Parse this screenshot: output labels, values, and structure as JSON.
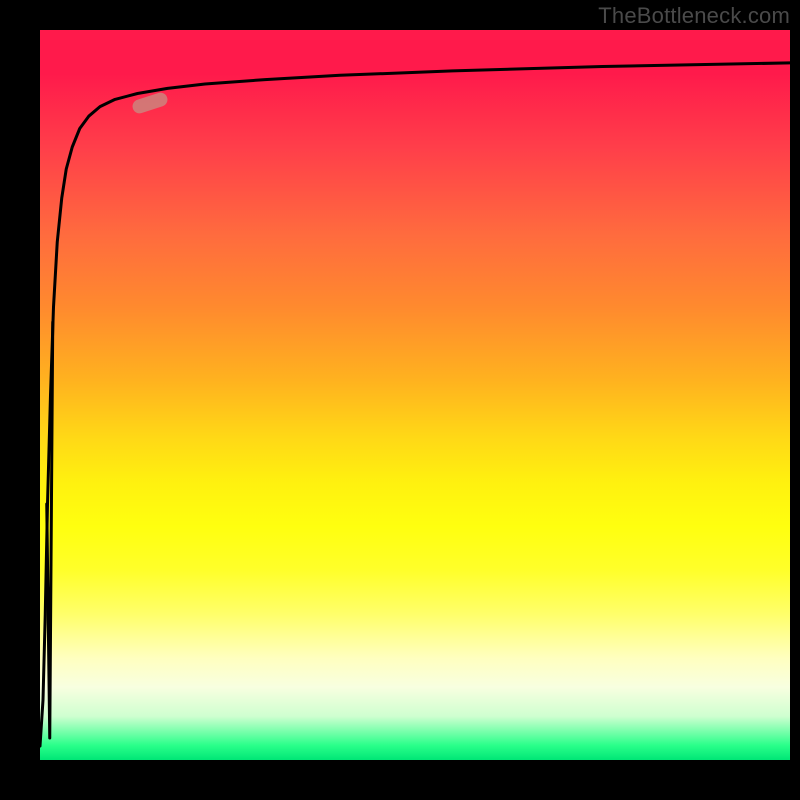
{
  "watermark": "TheBottleneck.com",
  "chart_data": {
    "type": "line",
    "title": "",
    "xlabel": "",
    "ylabel": "",
    "xlim": [
      0,
      100
    ],
    "ylim": [
      0,
      100
    ],
    "grid": false,
    "legend": false,
    "series": [
      {
        "name": "curve",
        "x": [
          0,
          0.4,
          0.7,
          1.0,
          1.4,
          1.8,
          2.3,
          2.9,
          3.5,
          4.3,
          5.3,
          6.5,
          8.0,
          10.0,
          13.0,
          17.0,
          22.0,
          30.0,
          40.0,
          55.0,
          75.0,
          100.0
        ],
        "y": [
          2,
          8,
          20,
          35,
          50,
          62,
          71,
          77,
          81,
          84,
          86.5,
          88.2,
          89.5,
          90.5,
          91.3,
          92.0,
          92.6,
          93.2,
          93.8,
          94.4,
          95.0,
          95.5
        ]
      },
      {
        "name": "inner-dip",
        "x": [
          0.9,
          1.3,
          1.7
        ],
        "y": [
          35,
          3,
          60
        ]
      }
    ],
    "marker": {
      "x": 17,
      "y": 89,
      "angle_deg": -18
    },
    "background_gradient": {
      "top": "#ff1a4b",
      "mid": "#ffff0f",
      "bottom": "#00e676"
    }
  }
}
